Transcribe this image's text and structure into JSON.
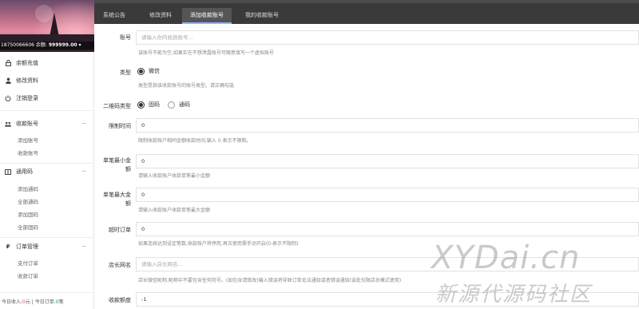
{
  "profile": {
    "phone": "18750066606",
    "balance_label": "余额:",
    "balance_value": "999999.00"
  },
  "sidebar": {
    "items": [
      {
        "label": "余额充值",
        "icon": "lock-icon"
      },
      {
        "label": "修改资料",
        "icon": "user-icon"
      },
      {
        "label": "注销登录",
        "icon": "power-icon"
      },
      {
        "label": "收款账号",
        "icon": "group-icon",
        "sub": [
          "添加账号",
          "收款账号"
        ]
      },
      {
        "label": "通用码",
        "icon": "book-icon",
        "sub": [
          "添加通码",
          "全部通码",
          "添加固码",
          "全部固码"
        ]
      },
      {
        "label": "订单管理",
        "icon": "p-icon",
        "sub": [
          "支付订单",
          "收款订单"
        ]
      }
    ],
    "stats": {
      "today_income_label": "今日收入:",
      "today_income_value": "0",
      "today_income_unit": "元",
      "today_orders_label": "今日订单:",
      "today_orders_value": "0",
      "today_orders_unit": "笔"
    }
  },
  "tabs": [
    {
      "label": "系统公告",
      "active": false
    },
    {
      "label": "修改资料",
      "active": false
    },
    {
      "label": "添加收款账号",
      "active": true
    },
    {
      "label": "我的收款账号",
      "active": false
    }
  ],
  "form": {
    "account": {
      "label": "账号",
      "placeholder": "请输入你的收款账号...",
      "hint": "该账号不能为空,如果实在不想泄露账号可随意填写一个虚拟账号"
    },
    "type": {
      "label": "类型",
      "option": "微信",
      "hint": "类型是指该收款账号的账号类型。请正确勾选"
    },
    "qr_type": {
      "label": "二维码类型",
      "options": [
        "固码",
        "通码"
      ],
      "selected": 0
    },
    "time_limit": {
      "label": "限制时间",
      "value": "0",
      "hint": "限制收款账户相同金额收款时间,输入 0 表示不限制。"
    },
    "min_amount": {
      "label": "单笔最小金额",
      "value": "0",
      "hint": "请输入收款账户收款单笔最小金额"
    },
    "max_amount": {
      "label": "单笔最大金额",
      "value": "0",
      "hint": "请输入收款账户收款单笔最大金额"
    },
    "timeout": {
      "label": "超时订单",
      "value": "0",
      "hint": "如果连续达到设定笔数,收款账户将停用,再次使用需手动开启(0:表示不限制)"
    },
    "shop_name": {
      "label": "店长网名",
      "placeholder": "请输入店长网名...",
      "hint": "店长微信昵称,昵称中不要包含任何符号。(如包含请修改)输入错误将导致订单无法通知或者错误通知(该处仅限店员模式使用)"
    },
    "quota": {
      "label": "收款额度",
      "value": "-1"
    }
  },
  "watermark": {
    "line1": "XYDai.cn",
    "line2": "新源代源码社区"
  }
}
